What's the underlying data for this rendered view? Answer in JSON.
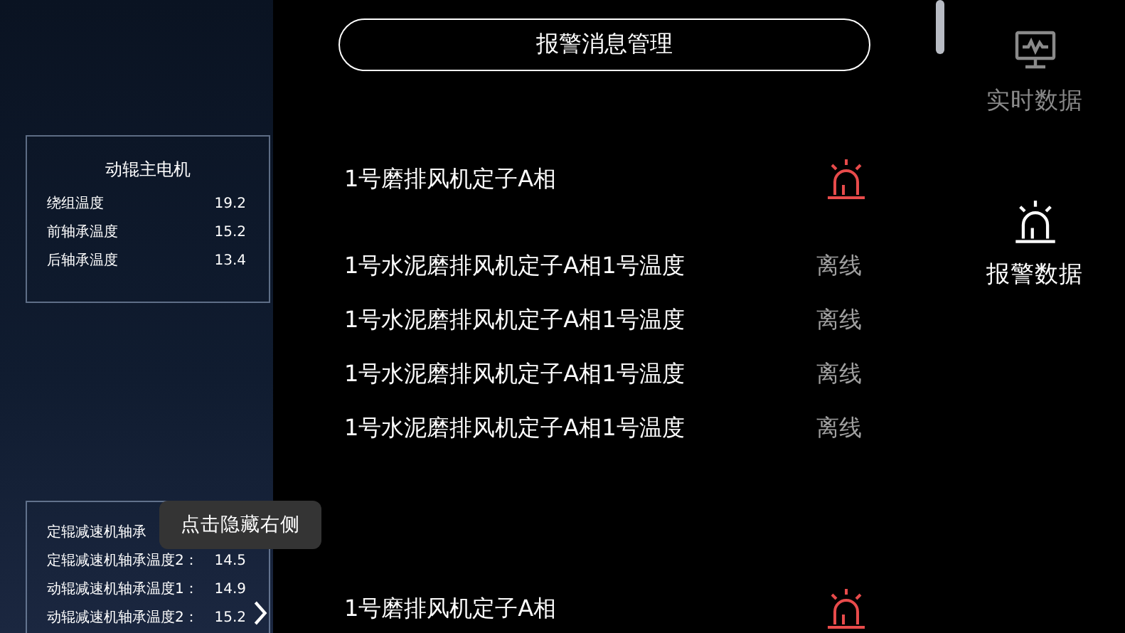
{
  "dashboard": {
    "cards": [
      {
        "title": "动辊主电机",
        "rows": [
          {
            "label": "绕组温度",
            "value": "19.2"
          },
          {
            "label": "前轴承温度",
            "value": "15.2"
          },
          {
            "label": "后轴承温度",
            "value": "13.4"
          }
        ]
      },
      {
        "rows": [
          {
            "label": "定辊减速机轴承",
            "value": ""
          },
          {
            "label": "定辊减速机轴承温度2：",
            "value": "14.5"
          },
          {
            "label": "动辊减速机轴承温度1：",
            "value": "14.9"
          },
          {
            "label": "动辊减速机轴承温度2：",
            "value": "15.2"
          }
        ]
      }
    ]
  },
  "tooltip": "点击隐藏右侧",
  "alarm_panel": {
    "title": "报警消息管理",
    "items": [
      {
        "kind": "alarm",
        "name": "1号磨排风机定子A相"
      },
      {
        "kind": "offline",
        "name": "1号水泥磨排风机定子A相1号温度",
        "status": "离线"
      },
      {
        "kind": "offline",
        "name": "1号水泥磨排风机定子A相1号温度",
        "status": "离线"
      },
      {
        "kind": "offline",
        "name": "1号水泥磨排风机定子A相1号温度",
        "status": "离线"
      },
      {
        "kind": "offline",
        "name": "1号水泥磨排风机定子A相1号温度",
        "status": "离线"
      },
      {
        "kind": "alarm",
        "name": "1号磨排风机定子A相"
      }
    ]
  },
  "sidebar": {
    "items": [
      {
        "kind": "monitor",
        "label": "实时数据",
        "selected": false
      },
      {
        "kind": "siren",
        "label": "报警数据",
        "selected": true
      }
    ]
  }
}
